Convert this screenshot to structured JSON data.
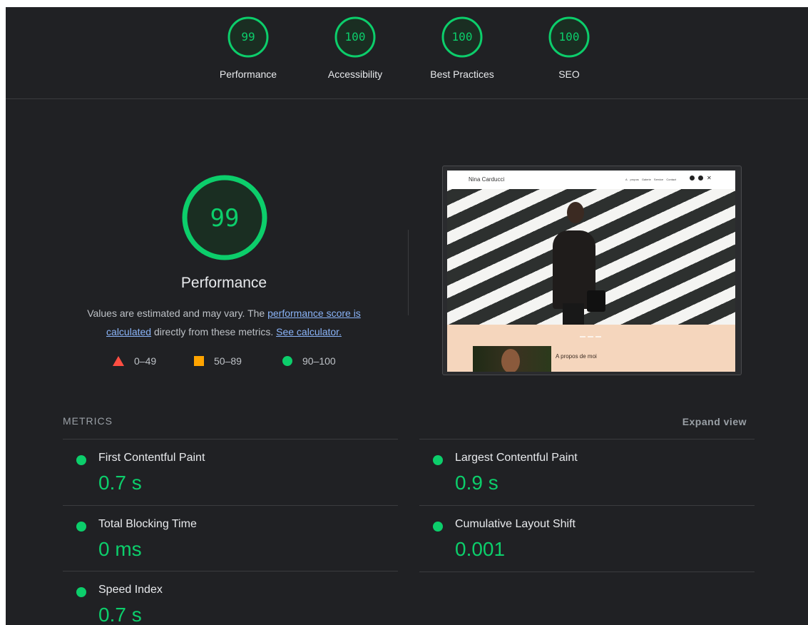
{
  "top_gauges": [
    {
      "score": "99",
      "label": "Performance"
    },
    {
      "score": "100",
      "label": "Accessibility"
    },
    {
      "score": "100",
      "label": "Best Practices"
    },
    {
      "score": "100",
      "label": "SEO"
    }
  ],
  "colors": {
    "pass": "#0cce6b",
    "average": "#ffa400",
    "fail": "#ff4e42",
    "background": "#202124",
    "link": "#8ab4f8"
  },
  "main": {
    "score": "99",
    "title": "Performance",
    "desc_part1": "Values are estimated and may vary. The ",
    "desc_link1": "performance score is calculated",
    "desc_part2": " directly from these metrics. ",
    "desc_link2": "See calculator.",
    "legend": [
      {
        "icon": "triangle-icon",
        "range": "0–49"
      },
      {
        "icon": "square-icon",
        "range": "50–89"
      },
      {
        "icon": "circle-icon",
        "range": "90–100"
      }
    ]
  },
  "screenshot": {
    "brand": "Nina Carducci",
    "nav": "A propos Galerie Service Contact",
    "about_text": "A propos de moi",
    "social_icons": [
      "instagram-icon",
      "facebook-icon",
      "x-icon"
    ]
  },
  "metrics": {
    "heading": "METRICS",
    "expand": "Expand view",
    "items": [
      {
        "name": "First Contentful Paint",
        "value": "0.7 s"
      },
      {
        "name": "Largest Contentful Paint",
        "value": "0.9 s"
      },
      {
        "name": "Total Blocking Time",
        "value": "0 ms"
      },
      {
        "name": "Cumulative Layout Shift",
        "value": "0.001"
      },
      {
        "name": "Speed Index",
        "value": "0.7 s"
      }
    ]
  }
}
